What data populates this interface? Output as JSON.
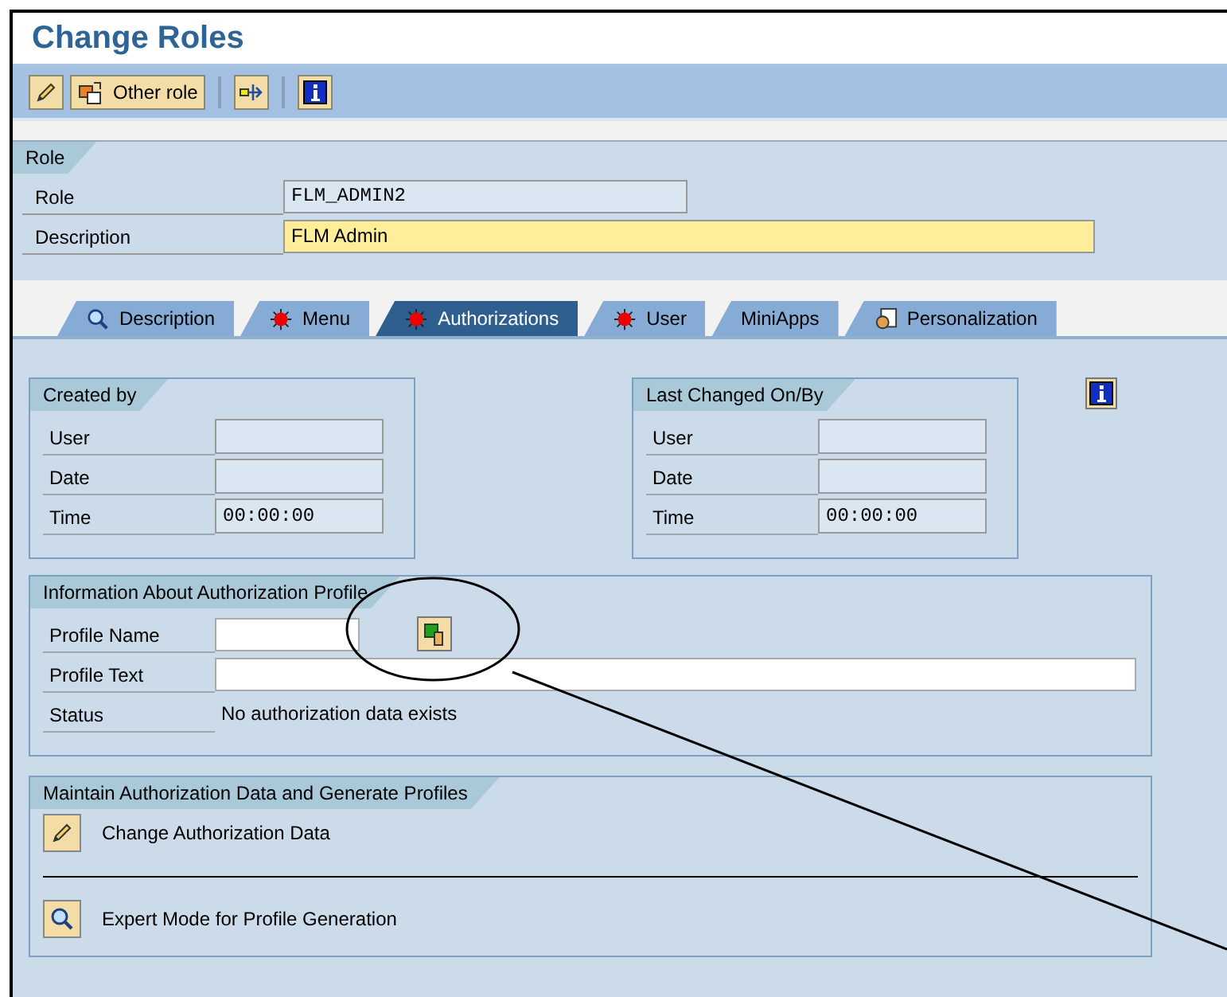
{
  "window": {
    "title": "Change Roles"
  },
  "toolbar": [
    {
      "kind": "icon"
    },
    {
      "kind": "button",
      "label": "Other role"
    },
    {
      "kind": "sep"
    },
    {
      "kind": "icon"
    },
    {
      "kind": "sep"
    },
    {
      "kind": "icon"
    }
  ],
  "role_group": {
    "title": "Role",
    "fields": [
      {
        "label": "Role",
        "value": "FLM_ADMIN2",
        "kind": "display"
      },
      {
        "label": "Description",
        "value": "FLM Admin",
        "kind": "edit"
      }
    ]
  },
  "tabs": [
    {
      "label": "Description",
      "selected": false
    },
    {
      "label": "Menu",
      "selected": false
    },
    {
      "label": "Authorizations",
      "selected": true
    },
    {
      "label": "User",
      "selected": false
    },
    {
      "label": "MiniApps",
      "selected": false
    },
    {
      "label": "Personalization",
      "selected": false
    }
  ],
  "created_by": {
    "title": "Created by",
    "fields": [
      {
        "label": "User"
      },
      {
        "label": "Date"
      },
      {
        "label": "Time",
        "value": "00:00:00"
      }
    ]
  },
  "last_changed": {
    "title": "Last Changed On/By",
    "fields": [
      {
        "label": "User"
      },
      {
        "label": "Date"
      },
      {
        "label": "Time",
        "value": "00:00:00"
      }
    ]
  },
  "profile_info": {
    "title": "Information About Authorization Profile",
    "profile_name_label": "Profile Name",
    "profile_text_label": "Profile Text",
    "status_label": "Status",
    "status_value": "No authorization data exists"
  },
  "maintain": {
    "title": "Maintain Authorization Data and Generate Profiles",
    "actions": [
      {
        "label": "Change Authorization Data"
      },
      {
        "label": "Expert Mode for Profile Generation"
      }
    ]
  }
}
